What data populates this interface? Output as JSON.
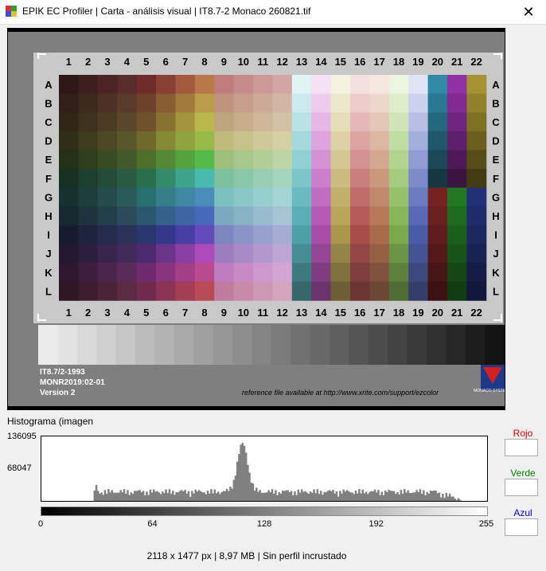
{
  "window": {
    "title": "EPIK EC Profiler | Carta - análisis visual | IT8.7-2 Monaco 260821.tif",
    "close_glyph": "✕"
  },
  "chart_image": {
    "columns": [
      "1",
      "2",
      "3",
      "4",
      "5",
      "6",
      "7",
      "8",
      "9",
      "10",
      "11",
      "12",
      "13",
      "14",
      "15",
      "16",
      "17",
      "18",
      "19",
      "20",
      "21",
      "22"
    ],
    "rows": [
      "A",
      "B",
      "C",
      "D",
      "E",
      "F",
      "G",
      "H",
      "I",
      "J",
      "K",
      "L"
    ],
    "info_line1": "IT8.7/2-1993",
    "info_line2": "MONR2019:02-01",
    "info_line3": "Version 2",
    "reference_text": "reference file available at http://www.xrite.com/support/ezcolor",
    "logo_text": "MONACO SYSTEMS"
  },
  "histogram": {
    "title": "Histograma (imagen",
    "max_label": "136095",
    "mid_label": "68047",
    "ticks": [
      "0",
      "64",
      "128",
      "192",
      "255"
    ],
    "tick_values": [
      0,
      64,
      128,
      192,
      255
    ],
    "bar_color": "#808080"
  },
  "channels": {
    "red": {
      "label": "Rojo",
      "color": "#e00000",
      "value": ""
    },
    "green": {
      "label": "Verde",
      "color": "#008000",
      "value": ""
    },
    "blue": {
      "label": "Azul",
      "color": "#0000e0",
      "value": ""
    }
  },
  "footer": {
    "info": "2118 x 1477 px | 8,97 MB | Sin perfil incrustado"
  }
}
